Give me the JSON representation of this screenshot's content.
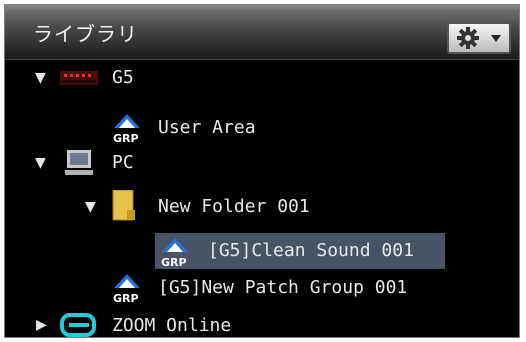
{
  "panel": {
    "title": "ライブラリ",
    "settings_icon": "gear-icon"
  },
  "tree": [
    {
      "label": "G5",
      "icon": "g5-device-icon",
      "expanded": true
    },
    {
      "label": "User Area",
      "icon": "grp-icon"
    },
    {
      "label": "PC",
      "icon": "computer-icon",
      "expanded": true
    },
    {
      "label": "New Folder 001",
      "icon": "folder-icon",
      "expanded": true
    },
    {
      "label": "[G5]Clean Sound 001",
      "icon": "grp-icon",
      "selected": true
    },
    {
      "label": "[G5]New Patch Group 001",
      "icon": "grp-icon"
    },
    {
      "label": "ZOOM Online",
      "icon": "zoom-online-icon",
      "expanded": false
    }
  ],
  "colors": {
    "selection": "#485466",
    "background": "#000000",
    "text": "#e8e8e8"
  }
}
